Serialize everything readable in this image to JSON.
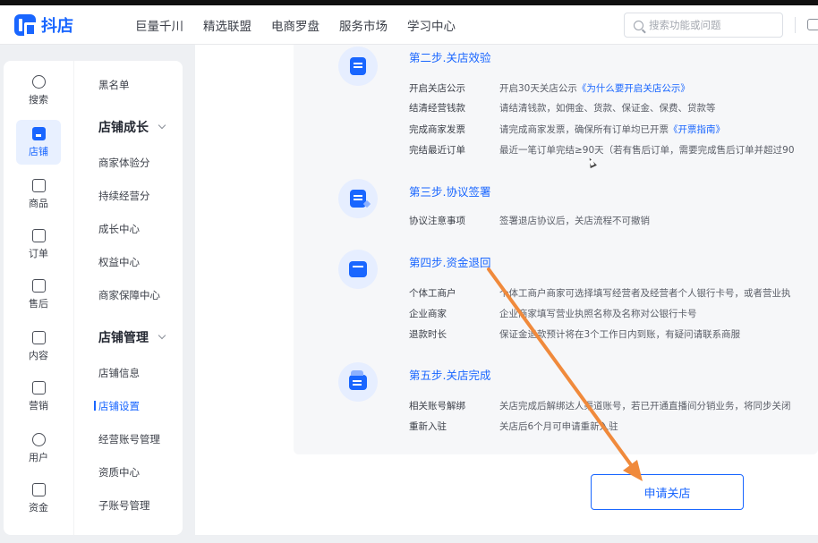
{
  "app": {
    "name": "抖店"
  },
  "header": {
    "nav": [
      "巨量千川",
      "精选联盟",
      "电商罗盘",
      "服务市场",
      "学习中心"
    ],
    "search_placeholder": "搜索功能或问题"
  },
  "rail": [
    {
      "label": "搜索",
      "icon": "search-icon",
      "active": false
    },
    {
      "label": "店铺",
      "icon": "shop-icon",
      "active": true
    },
    {
      "label": "商品",
      "icon": "bag-icon",
      "active": false
    },
    {
      "label": "订单",
      "icon": "order-icon",
      "active": false
    },
    {
      "label": "售后",
      "icon": "aftersale-icon",
      "active": false
    },
    {
      "label": "内容",
      "icon": "tv-icon",
      "active": false
    },
    {
      "label": "营销",
      "icon": "megaphone-icon",
      "active": false
    },
    {
      "label": "用户",
      "icon": "user-icon",
      "active": false
    },
    {
      "label": "资金",
      "icon": "wallet-icon",
      "active": false
    }
  ],
  "submenu": {
    "top_item": "黑名单",
    "group1": {
      "title": "店铺成长",
      "items": [
        "商家体验分",
        "持续经营分",
        "成长中心",
        "权益中心",
        "商家保障中心"
      ]
    },
    "group2": {
      "title": "店铺管理",
      "items": [
        "店铺信息",
        "店铺设置",
        "经营账号管理",
        "资质中心",
        "子账号管理"
      ]
    },
    "current": "店铺设置"
  },
  "steps": [
    {
      "title": "第二步.关店效验",
      "rows": [
        {
          "label": "开启关店公示",
          "value": "开启30天关店公示",
          "link": "《为什么要开启关店公示》"
        },
        {
          "label": "结清经营钱款",
          "value": "请结清钱款，如佣金、货款、保证金、保费、贷款等",
          "link": ""
        },
        {
          "label": "完成商家发票",
          "value": "请完成商家发票，确保所有订单均已开票",
          "link": "《开票指南》"
        },
        {
          "label": "完结最近订单",
          "value": "最近一笔订单完结≥90天（若有售后订单，需要完成售后订单并超过90",
          "link": ""
        }
      ]
    },
    {
      "title": "第三步.协议签署",
      "rows": [
        {
          "label": "协议注意事项",
          "value": "签署退店协议后，关店流程不可撤销",
          "link": ""
        }
      ]
    },
    {
      "title": "第四步.资金退回",
      "rows": [
        {
          "label": "个体工商户",
          "value": "个体工商户商家可选择填写经营者及经营者个人银行卡号，或者营业执",
          "link": ""
        },
        {
          "label": "企业商家",
          "value": "企业商家填写营业执照名称及名称对公银行卡号",
          "link": ""
        },
        {
          "label": "退款时长",
          "value": "保证金退款预计将在3个工作日内到账，有疑问请联系商服",
          "link": ""
        }
      ]
    },
    {
      "title": "第五步.关店完成",
      "rows": [
        {
          "label": "相关账号解绑",
          "value": "关店完成后解绑达人渠道账号，若已开通直播间分销业务，将同步关闭",
          "link": ""
        },
        {
          "label": "重新入驻",
          "value": "关店后6个月可申请重新入驻",
          "link": ""
        }
      ]
    }
  ],
  "apply_button": "申请关店",
  "accent_color": "#1966ff",
  "annotation_color": "#f08a3c"
}
